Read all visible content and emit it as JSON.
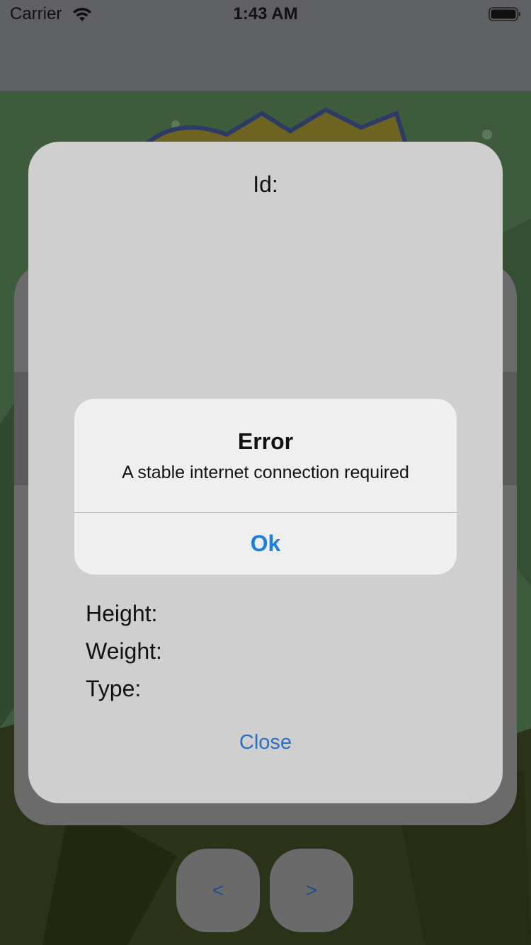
{
  "status_bar": {
    "carrier": "Carrier",
    "time": "1:43 AM",
    "wifi_icon": "wifi-icon",
    "battery_icon": "battery-icon"
  },
  "detail": {
    "id_label": "Id:",
    "height_label": "Height:",
    "weight_label": "Weight:",
    "type_label": "Type:",
    "close_label": "Close"
  },
  "alert": {
    "title": "Error",
    "message": "A stable internet connection required",
    "ok_label": "Ok"
  },
  "pager": {
    "prev_label": "<",
    "next_label": ">"
  },
  "colors": {
    "accent": "#1a7ee6",
    "link": "#2a6fc4",
    "bar": "#5f6165",
    "card": "#cfcfcf",
    "alert_bg": "#efefef"
  }
}
